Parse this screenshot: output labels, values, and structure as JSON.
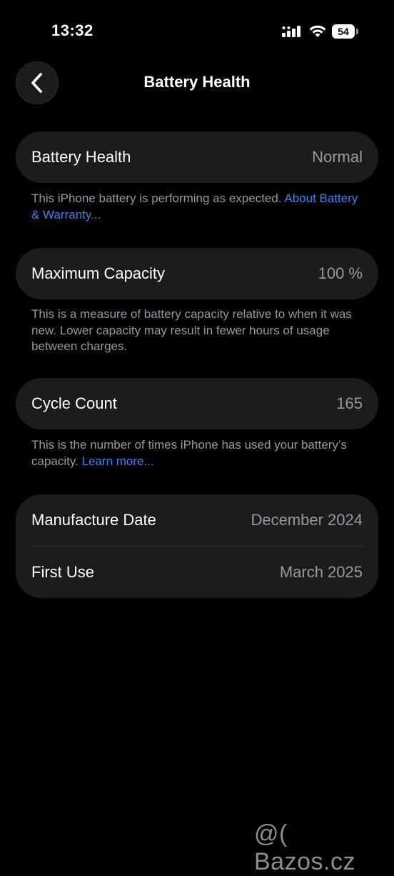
{
  "status_bar": {
    "time": "13:32",
    "battery_level": "54",
    "icons": [
      "signal-icon",
      "wifi-icon",
      "battery-icon"
    ]
  },
  "nav": {
    "title": "Battery Health",
    "back_icon": "chevron-left-icon"
  },
  "health": {
    "label": "Battery Health",
    "value": "Normal",
    "footnote": "This iPhone battery is performing as expected.",
    "footnote_link": "About Battery & Warranty..."
  },
  "capacity": {
    "label": "Maximum Capacity",
    "value": "100 %",
    "footnote": "This is a measure of battery capacity relative to when it was new. Lower capacity may result in fewer hours of usage between charges."
  },
  "cycles": {
    "label": "Cycle Count",
    "value": "165",
    "footnote": "This is the number of times iPhone has used your battery’s capacity.",
    "footnote_link": "Learn more..."
  },
  "dates": {
    "manufacture_label": "Manufacture Date",
    "manufacture_value": "December 2024",
    "first_use_label": "First Use",
    "first_use_value": "March 2025"
  },
  "watermark": "@( Bazos.cz",
  "colors": {
    "background": "#000000",
    "card": "#1c1c1e",
    "secondary_text": "#98989f",
    "link": "#3b82f6"
  }
}
